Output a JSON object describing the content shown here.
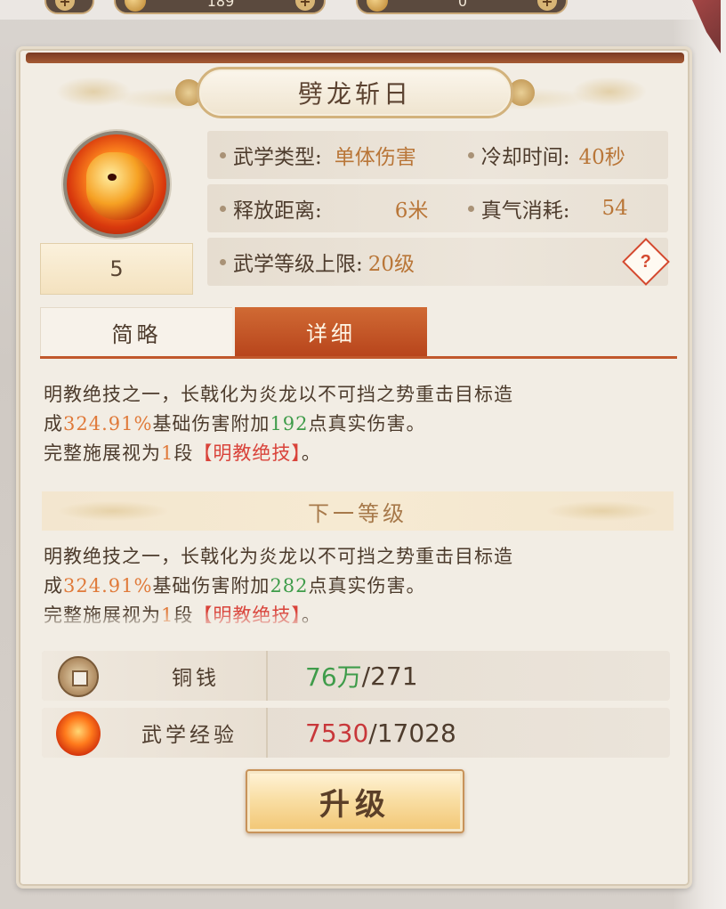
{
  "currencies": [
    {
      "icon": "coin-icon",
      "value": "189"
    },
    {
      "icon": "coin-icon",
      "value": "0"
    }
  ],
  "skill": {
    "title": "劈龙斩日",
    "icon": "dragon-flame-icon",
    "level": "5"
  },
  "stats": {
    "type_label": "武学类型:",
    "type_value": "单体伤害",
    "cooldown_label": "冷却时间:",
    "cooldown_value": "40秒",
    "range_label": "释放距离:",
    "range_value": "6米",
    "qi_label": "真气消耗:",
    "qi_value": "54",
    "level_cap_label": "武学等级上限:",
    "level_cap_value": "20级",
    "help_symbol": "?"
  },
  "tabs": {
    "brief": "简略",
    "detail": "详细",
    "active": "detail"
  },
  "current_desc": {
    "line1": "明教绝技之一，长戟化为炎龙以不可挡之势重击目标造",
    "line2_pre": "成",
    "line2_pct": "324.91%",
    "line2_mid": "基础伤害附加",
    "line2_num": "192",
    "line2_post": "点真实伤害。",
    "line3_pre": "完整施展视为",
    "line3_num": "1",
    "line3_mid": "段",
    "line3_tag": "【明教绝技】",
    "line3_post": "。"
  },
  "next_level": {
    "header": "下一等级",
    "line1": "明教绝技之一，长戟化为炎龙以不可挡之势重击目标造",
    "line2_pre": "成",
    "line2_pct": "324.91%",
    "line2_mid": "基础伤害附加",
    "line2_num": "282",
    "line2_post": "点真实伤害。",
    "line3_pre": "完整施展视为",
    "line3_num": "1",
    "line3_mid": "段",
    "line3_tag": "【明教绝技】",
    "line3_post": "。"
  },
  "resources": {
    "copper_label": "铜钱",
    "copper_have": "76万",
    "copper_need": "/271",
    "exp_label": "武学经验",
    "exp_have": "7530",
    "exp_need": "/17028"
  },
  "upgrade_button": "升级",
  "colors": {
    "accent_orange": "#c1582c",
    "value_orange": "#e07a3a",
    "value_green": "#3f9c4a",
    "value_red": "#c8373a",
    "tag_red": "#d9433a"
  }
}
